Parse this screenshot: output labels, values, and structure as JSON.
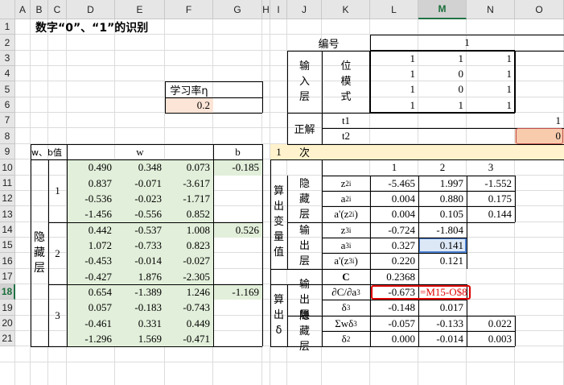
{
  "columns": [
    "A",
    "B",
    "C",
    "D",
    "E",
    "F",
    "G",
    "H",
    "I",
    "J",
    "K",
    "L",
    "M",
    "N",
    "O"
  ],
  "rows": [
    "1",
    "2",
    "3",
    "4",
    "5",
    "6",
    "7",
    "8",
    "9",
    "10",
    "11",
    "12",
    "13",
    "14",
    "15",
    "16",
    "17",
    "18",
    "19",
    "20",
    "21"
  ],
  "active_cell": "M18",
  "colors": {
    "grid": "#dcdcdc",
    "green_fill": "#e2efda",
    "peach_fill": "#fce4d6",
    "yellow_fill": "#fff2cc",
    "error_red": "#e00000",
    "selection_blue": "#4a7fd0"
  },
  "title": "数字“0”、“1”的识别",
  "learning_rate": {
    "label": "学习率η",
    "value": "0.2"
  },
  "wb_label": "w、b值",
  "w_header": "w",
  "b_header": "b",
  "hidden_layer_label": "隐藏层",
  "neuron_numbers": [
    "1",
    "2",
    "3"
  ],
  "weights": [
    [
      "0.490",
      "0.348",
      "0.073"
    ],
    [
      "0.837",
      "-0.071",
      "-3.617"
    ],
    [
      "-0.536",
      "-0.023",
      "-1.717"
    ],
    [
      "-1.456",
      "-0.556",
      "0.852"
    ],
    [
      "0.442",
      "-0.537",
      "1.008"
    ],
    [
      "1.072",
      "-0.733",
      "0.823"
    ],
    [
      "-0.453",
      "-0.014",
      "-0.027"
    ],
    [
      "-0.427",
      "1.876",
      "-2.305"
    ],
    [
      "0.654",
      "-1.389",
      "1.246"
    ],
    [
      "0.057",
      "-0.183",
      "-0.743"
    ],
    [
      "-0.461",
      "0.331",
      "0.449"
    ],
    [
      "-1.296",
      "1.569",
      "-0.471"
    ]
  ],
  "biases": [
    "-0.185",
    "0.526",
    "-1.169"
  ],
  "right": {
    "id_label": "编号",
    "id_value": "1",
    "input_layer": "输入层",
    "pattern_label": "位模式",
    "pattern": [
      [
        "1",
        "1",
        "1"
      ],
      [
        "1",
        "0",
        "1"
      ],
      [
        "1",
        "0",
        "1"
      ],
      [
        "1",
        "1",
        "1"
      ]
    ],
    "answer_label": "正解",
    "t1_label": "t1",
    "t1_value": "1",
    "t2_label": "t2",
    "t2_value": "0",
    "iter_value": "1",
    "iter_label": "次",
    "compute_vars_label": "算出变量值",
    "neuron_headers": [
      "1",
      "2",
      "3"
    ],
    "hidden_label": "隐藏层",
    "output_label": "输出层",
    "compute_delta_label": "算出δ",
    "hidden_rows": [
      {
        "label": "z²ᵢ",
        "values": [
          "-5.465",
          "1.997",
          "-1.552"
        ]
      },
      {
        "label": "a²ᵢ",
        "values": [
          "0.004",
          "0.880",
          "0.175"
        ]
      },
      {
        "label": "a'(z²ᵢ)",
        "values": [
          "0.004",
          "0.105",
          "0.144"
        ]
      }
    ],
    "output_rows": [
      {
        "label": "z³ᵢ",
        "values": [
          "-0.724",
          "-1.804"
        ]
      },
      {
        "label": "a³ᵢ",
        "values": [
          "0.327",
          "0.141"
        ]
      },
      {
        "label": "a'(z³ᵢ)",
        "values": [
          "0.220",
          "0.121"
        ]
      }
    ],
    "cost_label": "C",
    "cost_value": "0.2368",
    "delta_out_rows": [
      {
        "label": "∂C/∂a³",
        "values": [
          "-0.673",
          "=M15-O$8"
        ]
      },
      {
        "label": "δ³",
        "values": [
          "-0.148",
          "0.017"
        ]
      }
    ],
    "delta_hidden_rows": [
      {
        "label": "Σwδ³",
        "values": [
          "-0.057",
          "-0.133",
          "0.022"
        ]
      },
      {
        "label": "δ²",
        "values": [
          "0.000",
          "-0.014",
          "0.003"
        ]
      }
    ]
  }
}
